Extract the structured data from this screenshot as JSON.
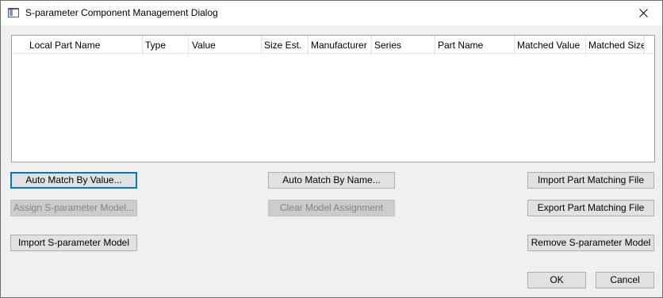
{
  "window": {
    "title": "S-parameter Component Management Dialog",
    "icon": "dialog-app-icon",
    "close_icon": "close-icon"
  },
  "table": {
    "columns": [
      "Local Part Name",
      "Type",
      "Value",
      "Size Est.",
      "Manufacturer",
      "Series",
      "Part Name",
      "Matched Value",
      "Matched Size"
    ],
    "rows": []
  },
  "buttons": {
    "auto_match_value": "Auto Match By Value...",
    "assign_model": "Assign S-parameter Model...",
    "import_model": "Import S-parameter Model",
    "auto_match_name": "Auto Match By Name...",
    "clear_assignment": "Clear Model Assignment",
    "import_matching": "Import Part Matching File",
    "export_matching": "Export Part Matching File",
    "remove_model": "Remove S-parameter Model",
    "ok": "OK",
    "cancel": "Cancel"
  },
  "colors": {
    "window_bg": "#f0f0f0",
    "button_bg": "#e1e1e1",
    "focus_border": "#0078d7",
    "disabled_text": "#838383"
  }
}
